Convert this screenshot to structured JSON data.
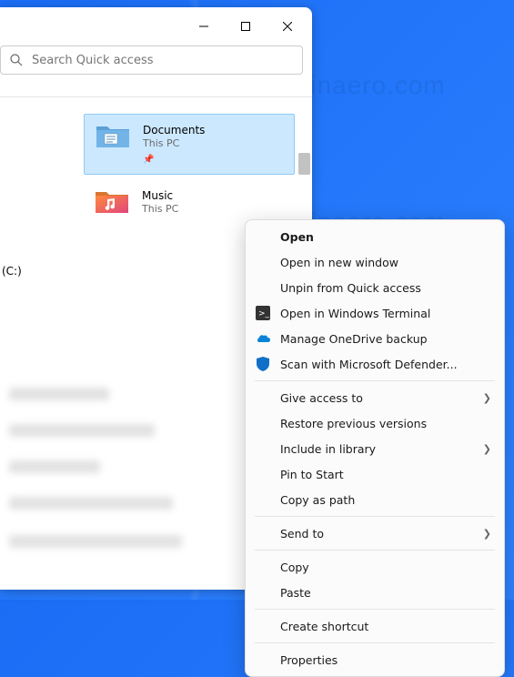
{
  "watermark": "winaero.com",
  "search": {
    "placeholder": "Search Quick access"
  },
  "drive_label": "(C:)",
  "folders": [
    {
      "name": "Documents",
      "location": "This PC",
      "pinned": true
    },
    {
      "name": "Music",
      "location": "This PC",
      "pinned": false
    }
  ],
  "context_menu": {
    "open": "Open",
    "open_new_window": "Open in new window",
    "unpin": "Unpin from Quick access",
    "open_terminal": "Open in Windows Terminal",
    "onedrive": "Manage OneDrive backup",
    "defender": "Scan with Microsoft Defender...",
    "give_access": "Give access to",
    "restore": "Restore previous versions",
    "include_library": "Include in library",
    "pin_start": "Pin to Start",
    "copy_path": "Copy as path",
    "send_to": "Send to",
    "copy": "Copy",
    "paste": "Paste",
    "create_shortcut": "Create shortcut",
    "properties": "Properties"
  }
}
